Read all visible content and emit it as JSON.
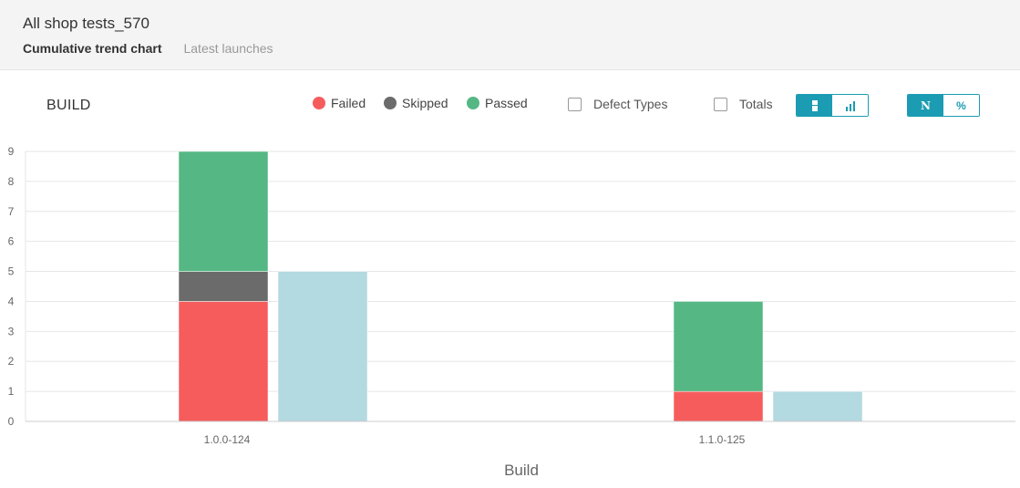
{
  "header": {
    "title": "All shop tests_570",
    "tabs": [
      {
        "label": "Cumulative trend chart",
        "active": true
      },
      {
        "label": "Latest launches",
        "active": false
      }
    ]
  },
  "controls": {
    "level_label": "BUILD",
    "legend": [
      {
        "label": "Failed",
        "color": "#f65c5c"
      },
      {
        "label": "Skipped",
        "color": "#6b6b6b"
      },
      {
        "label": "Passed",
        "color": "#55b784"
      }
    ],
    "defect_types": {
      "label": "Defect Types",
      "checked": false
    },
    "totals": {
      "label": "Totals",
      "checked": false
    },
    "view_mode": {
      "active": "stacked",
      "icons": [
        "stacked-bar-icon",
        "bar-chart-icon"
      ]
    },
    "value_mode": {
      "options": [
        "N",
        "%"
      ],
      "active": "N"
    }
  },
  "chart_data": {
    "type": "bar",
    "categories": [
      "1.0.0-124",
      "1.1.0-125"
    ],
    "series": [
      {
        "name": "Failed",
        "values": [
          4,
          1
        ],
        "color": "#f65c5c",
        "stack": "status"
      },
      {
        "name": "Skipped",
        "values": [
          1,
          0
        ],
        "color": "#6b6b6b",
        "stack": "status"
      },
      {
        "name": "Passed",
        "values": [
          4,
          3
        ],
        "color": "#55b784",
        "stack": "status"
      },
      {
        "values": [
          5,
          1
        ],
        "color": "#b3d9e1",
        "stack": "other"
      }
    ],
    "xlabel": "Build",
    "ylabel": "",
    "ylim": [
      0,
      9
    ],
    "yticks": [
      0,
      1,
      2,
      3,
      4,
      5,
      6,
      7,
      8,
      9
    ],
    "grid": true
  }
}
